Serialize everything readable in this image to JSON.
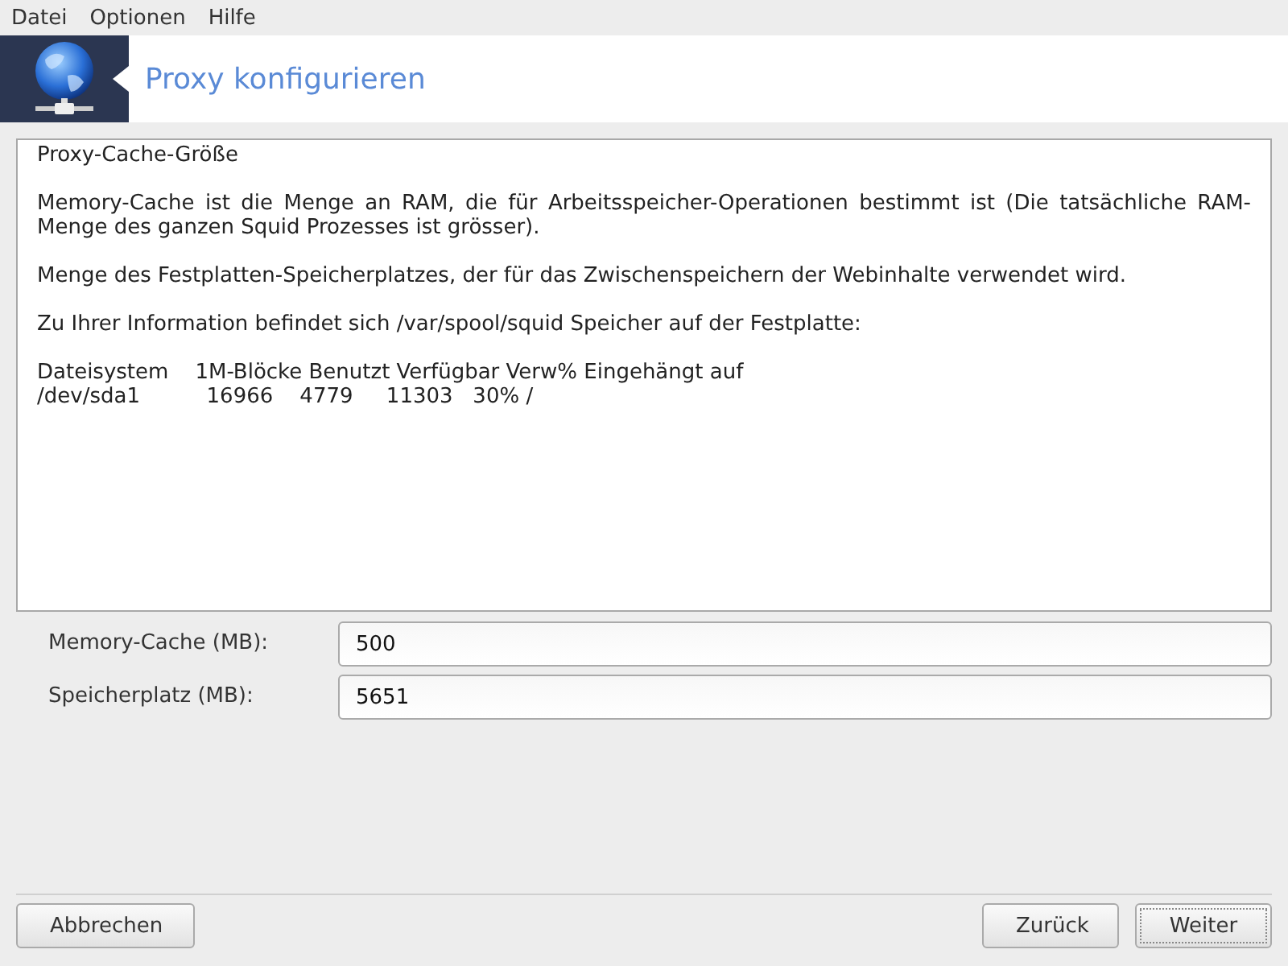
{
  "menu": [
    "Datei",
    "Optionen",
    "Hilfe"
  ],
  "header": {
    "title": "Proxy konfigurieren"
  },
  "info": {
    "heading": "Proxy-Cache-Größe",
    "paragraphs": [
      "Memory-Cache ist die Menge an RAM, die für Arbeitsspeicher-Operationen bestimmt ist (Die tatsächliche RAM-Menge des ganzen Squid Prozesses ist grösser).",
      "Menge des Festplatten-Speicherplatzes, der für das Zwischenspeichern der Webinhalte verwendet wird.",
      "Zu Ihrer Information befindet sich /var/spool/squid Speicher auf der Festplatte:"
    ],
    "table_lines": [
      "Dateisystem    1M-Blöcke Benutzt Verfügbar Verw% Eingehängt auf",
      "/dev/sda1          16966    4779     11303   30% /"
    ]
  },
  "fields": [
    {
      "label": "Memory-Cache (MB):",
      "value": "500"
    },
    {
      "label": "Speicherplatz (MB):",
      "value": "5651"
    }
  ],
  "buttons": [
    {
      "label": "Abbrechen",
      "focused": false
    },
    {
      "label": "Zurück",
      "focused": false
    },
    {
      "label": "Weiter",
      "focused": true
    }
  ]
}
